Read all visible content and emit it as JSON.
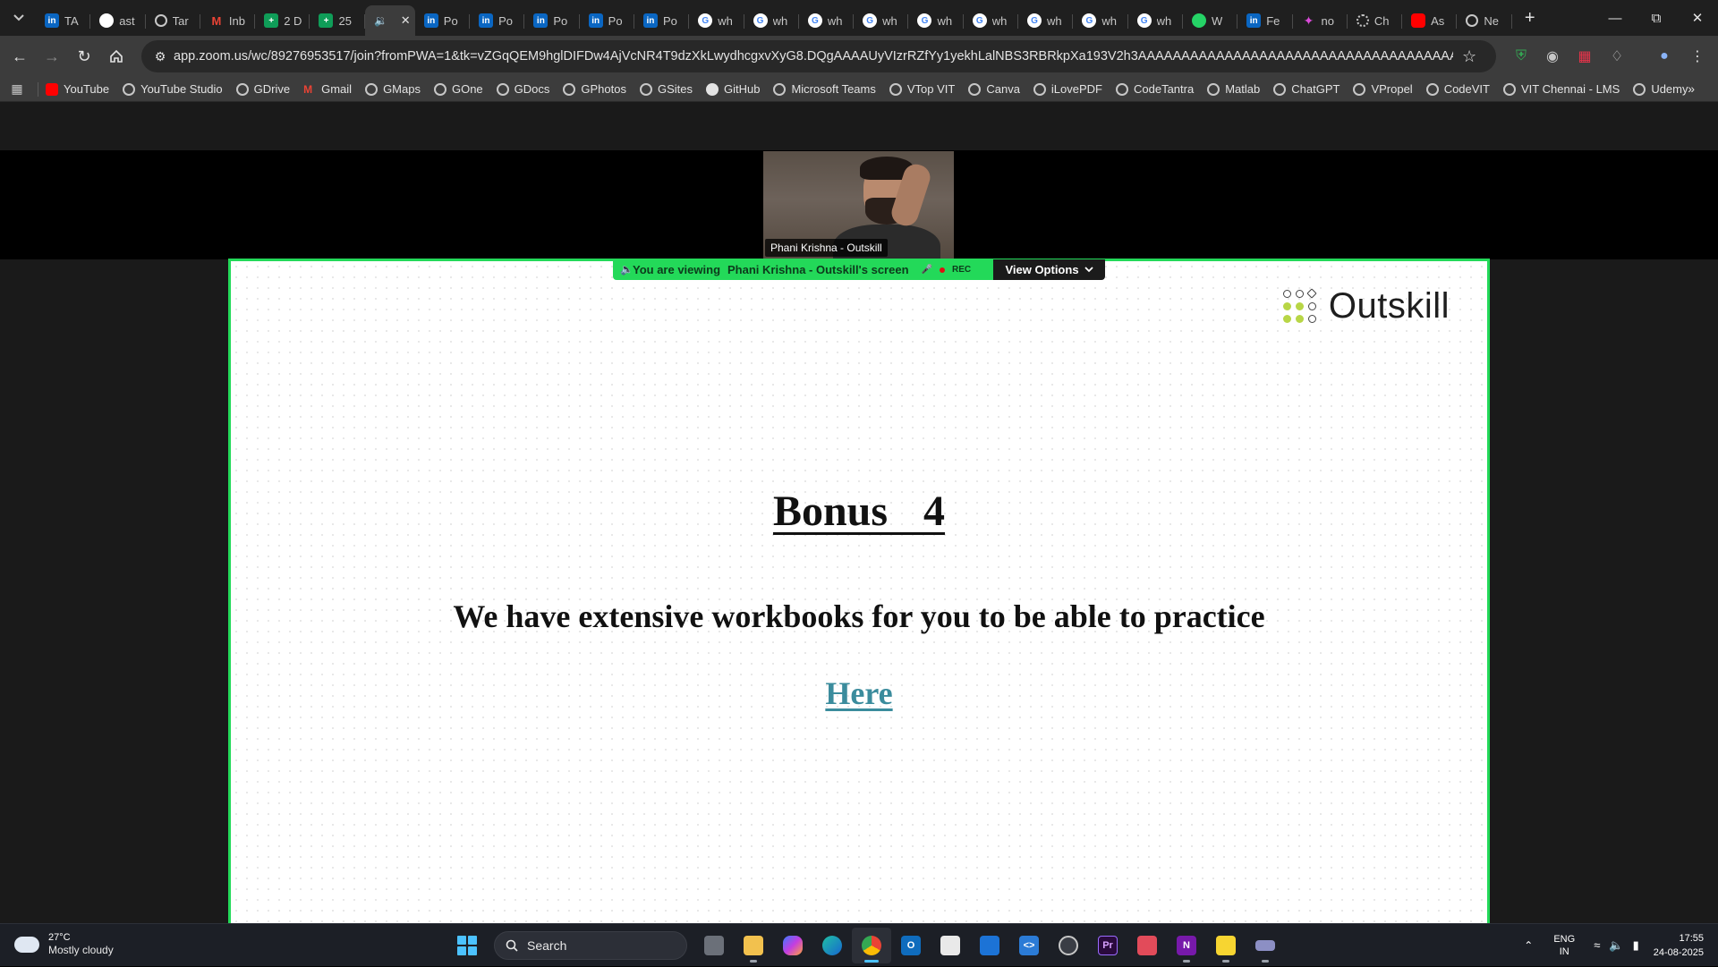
{
  "browser": {
    "tabs": [
      {
        "label": "TA",
        "icon": "linkedin-icon"
      },
      {
        "label": "ast",
        "icon": "github-icon"
      },
      {
        "label": "Tar",
        "icon": "globe-icon"
      },
      {
        "label": "Inb",
        "icon": "gmail-icon"
      },
      {
        "label": "2 D",
        "icon": "sheets-icon"
      },
      {
        "label": "25",
        "icon": "sheets-icon"
      },
      {
        "label": "",
        "icon": "speaker-icon",
        "active": true
      },
      {
        "label": "Po",
        "icon": "linkedin-icon"
      },
      {
        "label": "Po",
        "icon": "linkedin-icon"
      },
      {
        "label": "Po",
        "icon": "linkedin-icon"
      },
      {
        "label": "Po",
        "icon": "linkedin-icon"
      },
      {
        "label": "Po",
        "icon": "linkedin-icon"
      },
      {
        "label": "wh",
        "icon": "google-icon"
      },
      {
        "label": "wh",
        "icon": "google-icon"
      },
      {
        "label": "wh",
        "icon": "google-icon"
      },
      {
        "label": "wh",
        "icon": "google-icon"
      },
      {
        "label": "wh",
        "icon": "google-icon"
      },
      {
        "label": "wh",
        "icon": "google-icon"
      },
      {
        "label": "wh",
        "icon": "google-icon"
      },
      {
        "label": "wh",
        "icon": "google-icon"
      },
      {
        "label": "wh",
        "icon": "google-icon"
      },
      {
        "label": "W",
        "icon": "whatsapp-icon"
      },
      {
        "label": "Fe",
        "icon": "linkedin-icon"
      },
      {
        "label": "no",
        "icon": "app-icon"
      },
      {
        "label": "Ch",
        "icon": "chatgpt-icon"
      },
      {
        "label": "As",
        "icon": "youtube-icon"
      },
      {
        "label": "Ne",
        "icon": "globe-icon"
      }
    ],
    "url": "app.zoom.us/wc/89276953517/join?fromPWA=1&tk=vZGqQEM9hglDIFDw4AjVcNR4T9dzXkLwydhcgxvXyG8.DQgAAAAUyVIzrRZfYy1yekhLalNBS3RBRkpXa193V2h3AAAAAAAAAAAAAAAAAAAAAAAAAAAAAAAAAAAAAAAAAA&_x_zm_r...",
    "bookmarks": [
      {
        "label": "YouTube",
        "icon": "youtube-icon"
      },
      {
        "label": "YouTube Studio",
        "icon": "globe-icon"
      },
      {
        "label": "GDrive",
        "icon": "globe-icon"
      },
      {
        "label": "Gmail",
        "icon": "gmail-icon"
      },
      {
        "label": "GMaps",
        "icon": "globe-icon"
      },
      {
        "label": "GOne",
        "icon": "globe-icon"
      },
      {
        "label": "GDocs",
        "icon": "globe-icon"
      },
      {
        "label": "GPhotos",
        "icon": "globe-icon"
      },
      {
        "label": "GSites",
        "icon": "globe-icon"
      },
      {
        "label": "GitHub",
        "icon": "github-icon"
      },
      {
        "label": "Microsoft Teams",
        "icon": "globe-icon"
      },
      {
        "label": "VTop VIT",
        "icon": "globe-icon"
      },
      {
        "label": "Canva",
        "icon": "globe-icon"
      },
      {
        "label": "iLovePDF",
        "icon": "globe-icon"
      },
      {
        "label": "CodeTantra",
        "icon": "globe-icon"
      },
      {
        "label": "Matlab",
        "icon": "globe-icon"
      },
      {
        "label": "ChatGPT",
        "icon": "chatgpt-icon"
      },
      {
        "label": "VPropel",
        "icon": "globe-icon"
      },
      {
        "label": "CodeVIT",
        "icon": "globe-icon"
      },
      {
        "label": "VIT Chennai - LMS",
        "icon": "globe-icon"
      },
      {
        "label": "Udemy",
        "icon": "globe-icon"
      }
    ]
  },
  "meeting": {
    "participant_name": "Phani Krishna - Outskill",
    "banner_prefix": "You are viewing",
    "banner_screen": "Phani Krishna - Outskill's screen",
    "rec_label": "REC",
    "view_options": "View Options",
    "accent_color": "#23d959"
  },
  "slide": {
    "logo_text": "Outskill",
    "title": "Bonus  4",
    "body": "We have extensive workbooks for you to be able to practice",
    "link": "Here",
    "link_color": "#3b8c9d"
  },
  "taskbar": {
    "weather_temp": "27°C",
    "weather_desc": "Mostly cloudy",
    "search_label": "Search",
    "lang_1": "ENG",
    "lang_2": "IN",
    "time": "17:55",
    "date": "24-08-2025"
  }
}
